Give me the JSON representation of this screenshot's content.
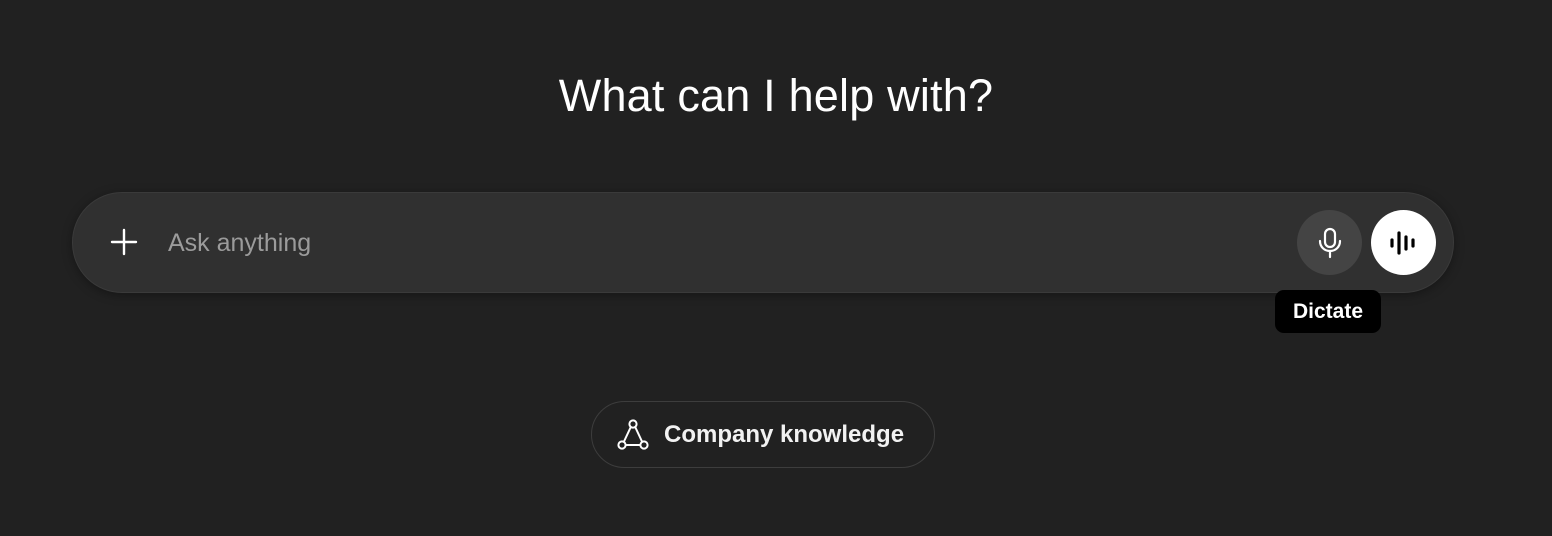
{
  "heading": "What can I help with?",
  "composer": {
    "placeholder": "Ask anything",
    "value": "",
    "add_icon": "plus-icon",
    "dictate_icon": "microphone-icon",
    "voice_icon": "voice-waveform-icon"
  },
  "tooltip": {
    "label": "Dictate"
  },
  "suggestions": [
    {
      "label": "Company knowledge",
      "icon": "connected-nodes-icon"
    }
  ],
  "colors": {
    "background": "#212121",
    "composer_bg": "#303030",
    "mic_button_bg": "#444444",
    "voice_button_bg": "#ffffff",
    "tooltip_bg": "#000000",
    "placeholder_text": "#9b9b9b"
  }
}
